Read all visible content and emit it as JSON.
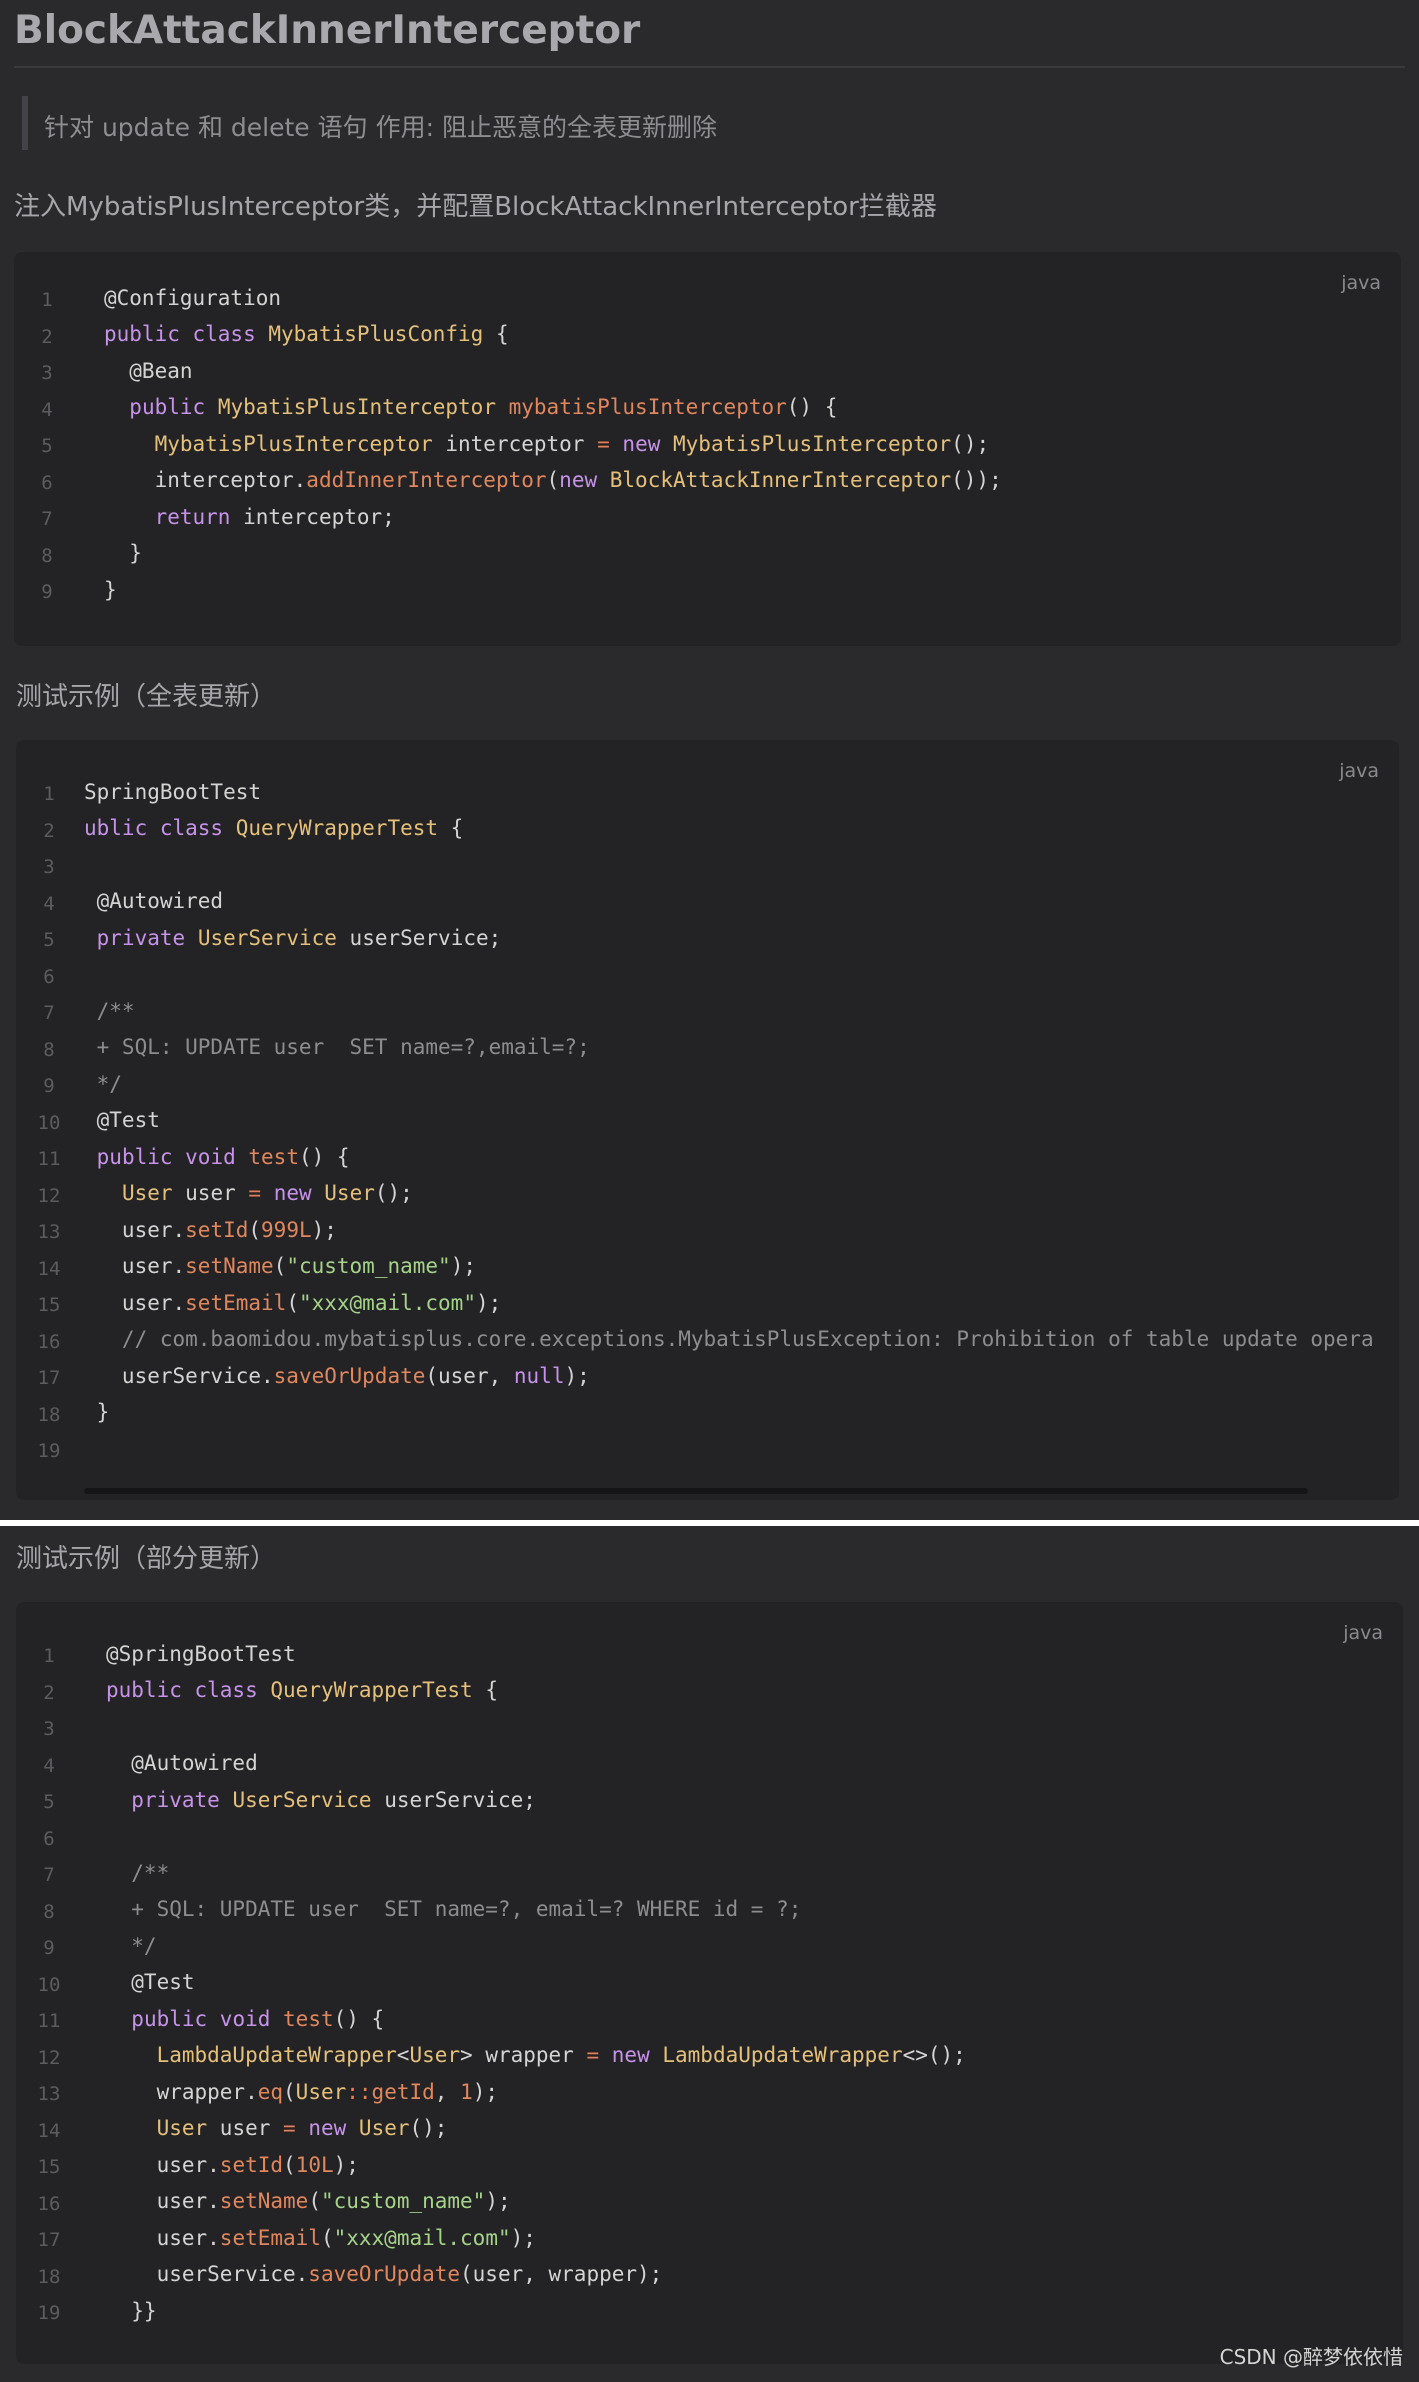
{
  "heading": "BlockAttackInnerInterceptor",
  "quote": "针对 update 和 delete 语句 作用: 阻止恶意的全表更新删除",
  "intro": "注入MybatisPlusInterceptor类，并配置BlockAttackInnerInterceptor拦截器",
  "section_full": "测试示例（全表更新）",
  "section_partial": "测试示例（部分更新）",
  "lang_label": "java",
  "watermark": "CSDN @醉梦依依惜",
  "code_config": {
    "line_numbers": [
      "1",
      "2",
      "3",
      "4",
      "5",
      "6",
      "7",
      "8",
      "9"
    ],
    "lines": [
      "@Configuration",
      "public class MybatisPlusConfig {",
      "  @Bean",
      "  public MybatisPlusInterceptor mybatisPlusInterceptor() {",
      "    MybatisPlusInterceptor interceptor = new MybatisPlusInterceptor();",
      "    interceptor.addInnerInterceptor(new BlockAttackInnerInterceptor());",
      "    return interceptor;",
      "  }",
      "}"
    ]
  },
  "code_full": {
    "line_numbers": [
      "1",
      "2",
      "3",
      "4",
      "5",
      "6",
      "7",
      "8",
      "9",
      "10",
      "11",
      "12",
      "13",
      "14",
      "15",
      "16",
      "17",
      "18",
      "19"
    ],
    "lines": [
      "SpringBootTest",
      "ublic class QueryWrapperTest {",
      "",
      " @Autowired",
      " private UserService userService;",
      "",
      " /**",
      " + SQL: UPDATE user  SET name=?,email=?;",
      " */",
      " @Test",
      " public void test() {",
      "   User user = new User();",
      "   user.setId(999L);",
      "   user.setName(\"custom_name\");",
      "   user.setEmail(\"xxx@mail.com\");",
      "   // com.baomidou.mybatisplus.core.exceptions.MybatisPlusException: Prohibition of table update opera",
      "   userService.saveOrUpdate(user, null);",
      " }",
      ""
    ]
  },
  "code_partial": {
    "line_numbers": [
      "1",
      "2",
      "3",
      "4",
      "5",
      "6",
      "7",
      "8",
      "9",
      "10",
      "11",
      "12",
      "13",
      "14",
      "15",
      "16",
      "17",
      "18",
      "19"
    ],
    "lines": [
      "@SpringBootTest",
      "public class QueryWrapperTest {",
      "",
      "  @Autowired",
      "  private UserService userService;",
      "",
      "  /**",
      "  + SQL: UPDATE user  SET name=?, email=? WHERE id = ?;",
      "  */",
      "  @Test",
      "  public void test() {",
      "    LambdaUpdateWrapper<User> wrapper = new LambdaUpdateWrapper<>();",
      "    wrapper.eq(User::getId, 1);",
      "    User user = new User();",
      "    user.setId(10L);",
      "    user.setName(\"custom_name\");",
      "    user.setEmail(\"xxx@mail.com\");",
      "    userService.saveOrUpdate(user, wrapper);",
      "  }}"
    ]
  }
}
